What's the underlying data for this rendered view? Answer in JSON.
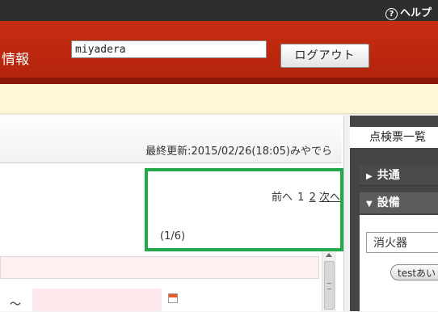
{
  "topbar": {
    "help_label": "ヘルプ",
    "help_symbol": "?"
  },
  "header": {
    "title": "情報",
    "username": "miyadera",
    "logout_label": "ログアウト"
  },
  "main": {
    "last_updated": "最終更新:2015/02/26(18:05)みやでら",
    "pager": {
      "prev_label": "前へ",
      "pages": [
        "1",
        "2"
      ],
      "next_label": "次へ",
      "current_page": "1"
    },
    "count_label": "(1/6)",
    "range_separator": "～"
  },
  "side": {
    "title": "点検票一覧",
    "sections": [
      {
        "label": "共通",
        "state": "collapsed",
        "arrow": "▶"
      },
      {
        "label": "設備",
        "state": "expanded",
        "arrow": "▼"
      }
    ],
    "selected_item": "消火器",
    "tag_label": "testあい"
  },
  "colors": {
    "header_red": "#c72d12",
    "notice_yellow": "#fff8d8",
    "highlight_green": "#23a94b",
    "side_dark": "#454545"
  }
}
